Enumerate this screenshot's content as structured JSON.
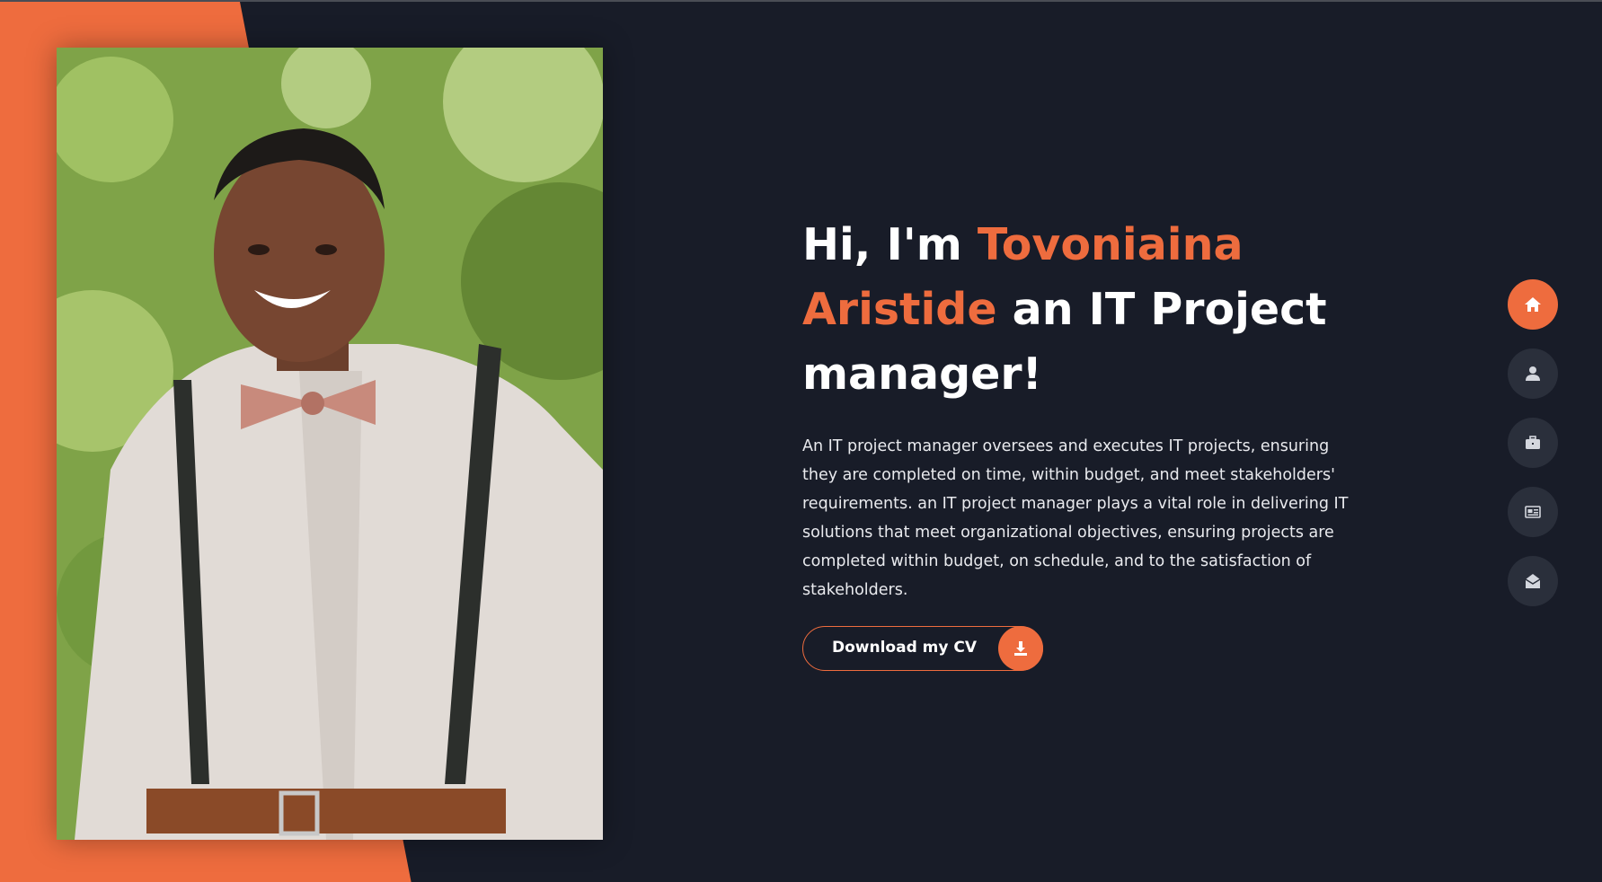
{
  "hero": {
    "greeting": "Hi, I'm",
    "name_first": "Tovoniaina",
    "name_last": "Aristide",
    "role_text": "an IT Project manager!",
    "description": "An IT project manager oversees and executes IT projects, ensuring they are completed on time, within budget, and meet stakeholders' requirements. an IT project manager plays a vital role in delivering IT solutions that meet organizational objectives, ensuring projects are completed within budget, on schedule, and to the satisfaction of stakeholders.",
    "cv_button_label": "Download my CV",
    "cv_button_icon": "download-icon"
  },
  "side_nav": [
    {
      "icon": "home-icon",
      "active": true
    },
    {
      "icon": "user-icon",
      "active": false
    },
    {
      "icon": "briefcase-icon",
      "active": false
    },
    {
      "icon": "newspaper-icon",
      "active": false
    },
    {
      "icon": "envelope-open-icon",
      "active": false
    }
  ],
  "colors": {
    "accent": "#ee6c3e",
    "background": "#181c28",
    "nav_inactive": "#2a2f3b",
    "text": "#ffffff"
  }
}
